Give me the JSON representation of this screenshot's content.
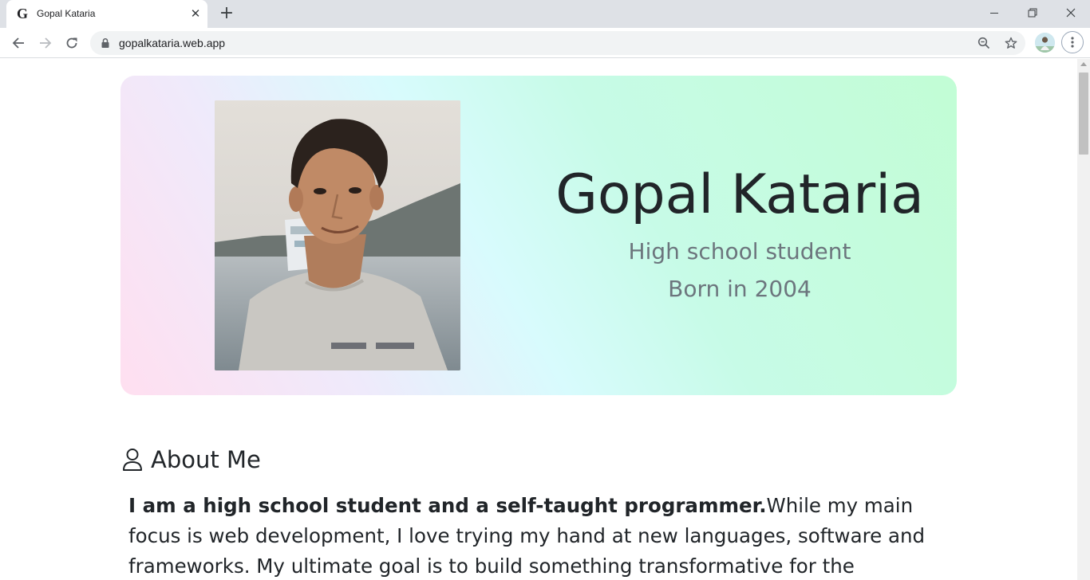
{
  "browser": {
    "tab_title": "Gopal Kataria",
    "tab_favicon": "G",
    "tab_close": "✕",
    "new_tab": "+",
    "url": "gopalkataria.web.app"
  },
  "hero": {
    "name": "Gopal Kataria",
    "subtitle": "High school student",
    "born": "Born in 2004"
  },
  "about": {
    "title": "About Me",
    "lead": "I am a high school student and a self-taught programmer.",
    "body": "While my main focus is web development, I love trying my hand at new languages, software and frameworks. My ultimate goal is to build something transformative for the"
  },
  "colors": {
    "accent_text": "#212529",
    "muted_text": "#6c757d"
  },
  "icons": [
    "back-arrow-icon",
    "forward-arrow-icon",
    "reload-icon",
    "lock-icon",
    "zoom-icon",
    "star-icon",
    "profile-avatar",
    "kebab-menu-icon",
    "person-icon"
  ]
}
